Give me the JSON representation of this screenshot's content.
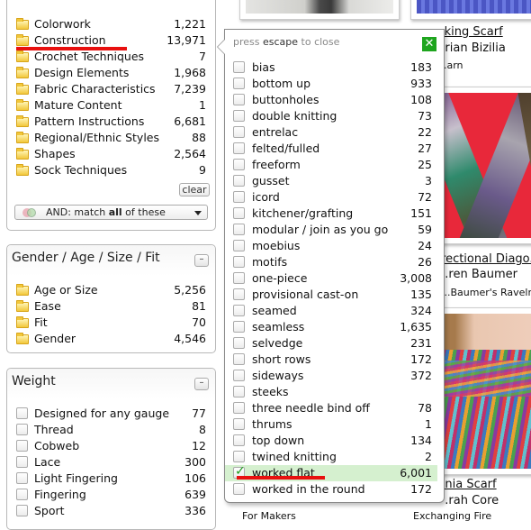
{
  "categories_panel": {
    "items": [
      {
        "label": "Colorwork",
        "count": "1,221"
      },
      {
        "label": "Construction",
        "count": "13,971"
      },
      {
        "label": "Crochet Techniques",
        "count": "7"
      },
      {
        "label": "Design Elements",
        "count": "1,968"
      },
      {
        "label": "Fabric Characteristics",
        "count": "7,239"
      },
      {
        "label": "Mature Content",
        "count": "1"
      },
      {
        "label": "Pattern Instructions",
        "count": "6,681"
      },
      {
        "label": "Regional/Ethnic Styles",
        "count": "88"
      },
      {
        "label": "Shapes",
        "count": "2,564"
      },
      {
        "label": "Sock Techniques",
        "count": "9"
      }
    ],
    "clear_label": "clear",
    "match_prefix": "AND: match ",
    "match_bold": "all",
    "match_suffix": " of these"
  },
  "gender_panel": {
    "title": "Gender / Age / Size / Fit",
    "collapse_label": "–",
    "items": [
      {
        "label": "Age or Size",
        "count": "5,256"
      },
      {
        "label": "Ease",
        "count": "81"
      },
      {
        "label": "Fit",
        "count": "70"
      },
      {
        "label": "Gender",
        "count": "4,546"
      }
    ]
  },
  "weight_panel": {
    "title": "Weight",
    "collapse_label": "–",
    "items": [
      {
        "label": "Designed for any gauge",
        "count": "77"
      },
      {
        "label": "Thread",
        "count": "8"
      },
      {
        "label": "Cobweb",
        "count": "12"
      },
      {
        "label": "Lace",
        "count": "300"
      },
      {
        "label": "Light Fingering",
        "count": "106"
      },
      {
        "label": "Fingering",
        "count": "639"
      },
      {
        "label": "Sport",
        "count": "336"
      }
    ]
  },
  "popup": {
    "hint_pre": "press ",
    "hint_key": "escape",
    "hint_post": " to close",
    "close_label": "✕",
    "items": [
      {
        "label": "bias",
        "count": "183",
        "checked": false
      },
      {
        "label": "bottom up",
        "count": "933",
        "checked": false
      },
      {
        "label": "buttonholes",
        "count": "108",
        "checked": false
      },
      {
        "label": "double knitting",
        "count": "73",
        "checked": false
      },
      {
        "label": "entrelac",
        "count": "22",
        "checked": false
      },
      {
        "label": "felted/fulled",
        "count": "27",
        "checked": false
      },
      {
        "label": "freeform",
        "count": "25",
        "checked": false
      },
      {
        "label": "gusset",
        "count": "3",
        "checked": false
      },
      {
        "label": "icord",
        "count": "72",
        "checked": false
      },
      {
        "label": "kitchener/grafting",
        "count": "151",
        "checked": false
      },
      {
        "label": "modular / join as you go",
        "count": "59",
        "checked": false
      },
      {
        "label": "moebius",
        "count": "24",
        "checked": false
      },
      {
        "label": "motifs",
        "count": "26",
        "checked": false
      },
      {
        "label": "one-piece",
        "count": "3,008",
        "checked": false
      },
      {
        "label": "provisional cast-on",
        "count": "135",
        "checked": false
      },
      {
        "label": "seamed",
        "count": "324",
        "checked": false
      },
      {
        "label": "seamless",
        "count": "1,635",
        "checked": false
      },
      {
        "label": "selvedge",
        "count": "231",
        "checked": false
      },
      {
        "label": "short rows",
        "count": "172",
        "checked": false
      },
      {
        "label": "sideways",
        "count": "372",
        "checked": false
      },
      {
        "label": "steeks",
        "count": "",
        "checked": false
      },
      {
        "label": "three needle bind off",
        "count": "78",
        "checked": false
      },
      {
        "label": "thrums",
        "count": "1",
        "checked": false
      },
      {
        "label": "top down",
        "count": "134",
        "checked": false
      },
      {
        "label": "twined knitting",
        "count": "2",
        "checked": false
      },
      {
        "label": "worked flat",
        "count": "6,001",
        "checked": true
      },
      {
        "label": "worked in the round",
        "count": "172",
        "checked": false
      }
    ]
  },
  "results": [
    {
      "title": "...liking Scarf",
      "designer": "...rian Bizilia",
      "source": "...arn"
    },
    {
      "title": "...irectional Diago...",
      "designer": "...ren Baumer",
      "source": "...Baumer's Ravelry S..."
    },
    {
      "title": "...ania Scarf",
      "designer": "...rah Core",
      "source": "Exchanging Fire"
    },
    {
      "source": "For Makers"
    }
  ],
  "colors": {
    "selected_bg": "#d5f0cf",
    "close_green": "#1ea51e",
    "annotation_red": "#e8100f"
  }
}
